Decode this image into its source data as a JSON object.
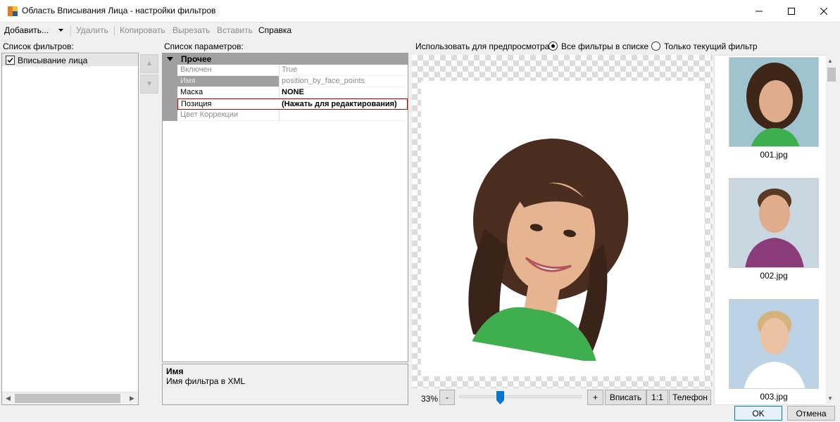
{
  "window": {
    "title": "Область Вписывания Лица - настройки фильтров",
    "minimize_icon": "minimize-icon",
    "maximize_icon": "maximize-icon",
    "close_icon": "close-icon"
  },
  "menu": {
    "add": "Добавить...",
    "delete": "Удалить",
    "copy": "Копировать",
    "cut": "Вырезать",
    "paste": "Вставить",
    "help": "Справка"
  },
  "filters": {
    "label": "Список фильтров:",
    "items": [
      {
        "label": "Вписывание лица",
        "checked": true
      }
    ]
  },
  "params": {
    "label": "Список параметров:",
    "category": "Прочее",
    "rows": [
      {
        "name": "Включен",
        "value": "True"
      },
      {
        "name": "Имя",
        "value": "position_by_face_points"
      },
      {
        "name": "Маска",
        "value": "NONE"
      },
      {
        "name": "Позиция",
        "value": "(Нажать для редактирования)"
      },
      {
        "name": "Цвет Коррекции",
        "value": ""
      }
    ],
    "description": {
      "title": "Имя",
      "text": "Имя фильтра в XML"
    }
  },
  "preview": {
    "use_label": "Использовать для предпросмотра:",
    "option_all": "Все фильтры в списке",
    "option_current": "Только текущий фильтр",
    "selected": "all",
    "zoom": "33%",
    "zoom_minus": "-",
    "zoom_plus": "+",
    "fit": "Вписать",
    "one_to_one": "1:1",
    "phone": "Телефон"
  },
  "thumbnails": [
    {
      "label": "001.jpg"
    },
    {
      "label": "002.jpg"
    },
    {
      "label": "003.jpg"
    }
  ],
  "footer": {
    "ok": "OK",
    "cancel": "Отмена"
  },
  "colors": {
    "accent": "#0078d7",
    "selection_border": "#c00000",
    "grid_category": "#a0a0a0"
  }
}
